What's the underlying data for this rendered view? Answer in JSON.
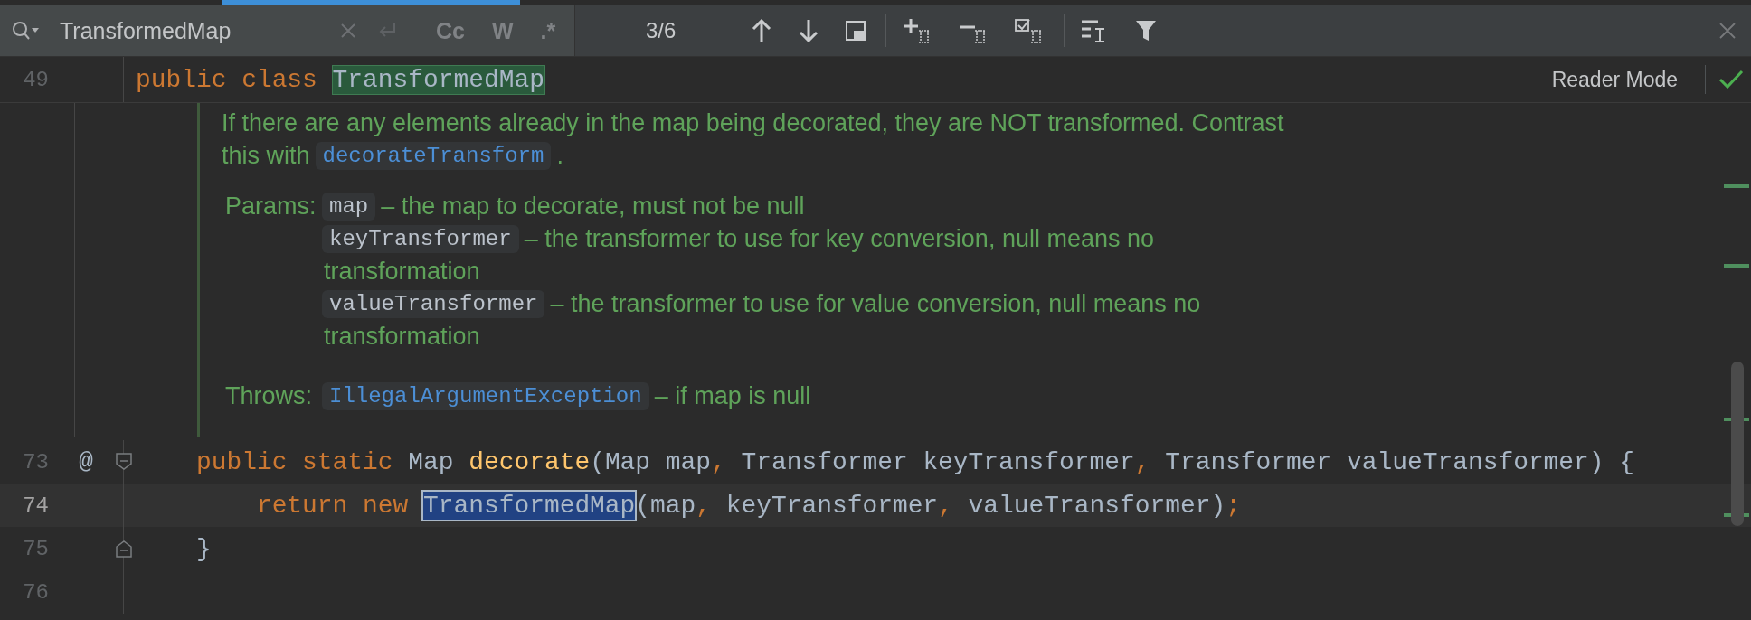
{
  "find_bar": {
    "query": "TransformedMap",
    "options": [
      {
        "label": "Cc",
        "on": false
      },
      {
        "label": "W",
        "on": false
      },
      {
        "label": ".*",
        "on": false
      }
    ],
    "match_count": "3/6"
  },
  "sticky_header": {
    "line_number": "49",
    "tokens": [
      {
        "kind": "keyword",
        "text": "public class "
      },
      {
        "kind": "match",
        "text": "TransformedMap"
      }
    ],
    "reader_mode": "Reader Mode"
  },
  "doc_comment": {
    "description": [
      [
        {
          "kind": "text",
          "text": "If there are any elements already in the map being decorated, they are NOT transformed. Contrast"
        }
      ],
      [
        {
          "kind": "text",
          "text": "this with"
        },
        {
          "kind": "link",
          "text": "decorateTransform"
        },
        {
          "kind": "text",
          "text": "."
        }
      ]
    ],
    "sections": [
      {
        "label": "Params:",
        "items": [
          {
            "name": "map",
            "link": false,
            "description": [
              "– the map to decorate, must not be null"
            ]
          },
          {
            "name": "keyTransformer",
            "link": false,
            "description": [
              "– the transformer to use for key conversion, null means no",
              "transformation"
            ]
          },
          {
            "name": "valueTransformer",
            "link": false,
            "description": [
              "– the transformer to use for value conversion, null means no",
              "transformation"
            ]
          }
        ]
      },
      {
        "label": "Throws:",
        "items": [
          {
            "name": "IllegalArgumentException",
            "link": true,
            "description": [
              "– if map is null"
            ]
          }
        ]
      }
    ]
  },
  "code_lines": [
    {
      "number": "73",
      "current": false,
      "annotation": "@",
      "fold": {
        "kind": "start"
      },
      "tokens": [
        {
          "kind": "keyword",
          "text": "    public static "
        },
        {
          "kind": "plain",
          "text": "Map "
        },
        {
          "kind": "method",
          "text": "decorate"
        },
        {
          "kind": "plain",
          "text": "(Map map"
        },
        {
          "kind": "keyword",
          "text": ", "
        },
        {
          "kind": "plain",
          "text": "Transformer keyTransformer"
        },
        {
          "kind": "keyword",
          "text": ", "
        },
        {
          "kind": "plain",
          "text": "Transformer valueTransformer) {"
        }
      ]
    },
    {
      "number": "74",
      "current": true,
      "tokens": [
        {
          "kind": "keyword",
          "text": "        return new "
        },
        {
          "kind": "current_match",
          "text": "TransformedMap"
        },
        {
          "kind": "plain",
          "text": "(map"
        },
        {
          "kind": "keyword",
          "text": ", "
        },
        {
          "kind": "plain",
          "text": "keyTransformer"
        },
        {
          "kind": "keyword",
          "text": ", "
        },
        {
          "kind": "plain",
          "text": "valueTransformer)"
        },
        {
          "kind": "keyword",
          "text": ";"
        }
      ]
    },
    {
      "number": "75",
      "current": false,
      "fold": {
        "kind": "end"
      },
      "tokens": [
        {
          "kind": "plain",
          "text": "    }"
        }
      ]
    },
    {
      "number": "76",
      "current": false
    }
  ]
}
